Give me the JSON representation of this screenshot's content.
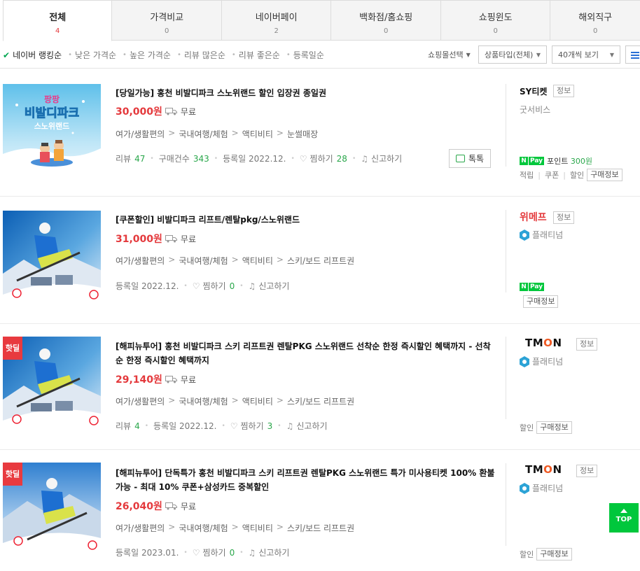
{
  "tabs": [
    {
      "label": "전체",
      "count": "4"
    },
    {
      "label": "가격비교",
      "count": "0"
    },
    {
      "label": "네이버페이",
      "count": "2"
    },
    {
      "label": "백화점/홈쇼핑",
      "count": "0"
    },
    {
      "label": "쇼핑윈도",
      "count": "0"
    },
    {
      "label": "해외직구",
      "count": "0"
    }
  ],
  "sort": {
    "options": [
      "네이버 랭킹순",
      "낮은 가격순",
      "높은 가격순",
      "리뷰 많은순",
      "리뷰 좋은순",
      "등록일순"
    ],
    "shop_select": "쇼핑몰선택",
    "product_type": "상품타입(전체)",
    "page_size": "40개씩 보기"
  },
  "labels": {
    "free_shipping": "무료",
    "review": "리뷰",
    "purchases": "구매건수",
    "registered": "등록일",
    "wish": "찜하기",
    "report": "신고하기",
    "talk": "톡톡",
    "info": "정보",
    "buy_info": "구매정보",
    "platinum": "플래티넘",
    "point": "포인트",
    "top": "TOP",
    "hotdeal": "핫딜",
    "npay_n": "N",
    "npay_pay": "Pay"
  },
  "products": [
    {
      "title": "[당일가능] 홍천 비발디파크 스노위랜드 할인 입장권 종일권",
      "price": "30,000원",
      "categories": [
        "여가/생활편의",
        "국내여행/체험",
        "액티비티",
        "눈썰매장"
      ],
      "review_count": "47",
      "purchase_count": "343",
      "reg_date": "2022.12.",
      "wish_count": "28",
      "seller": "SY티켓",
      "seller_sub": "굿서비스",
      "point_amount": "300원",
      "benefits": [
        "적립",
        "쿠폰",
        "할인"
      ],
      "thumb_text": [
        "팡팡",
        "비발디파크",
        "스노위랜드"
      ]
    },
    {
      "title": "[쿠폰할인] 비발디파크 리프트/렌탈pkg/스노위랜드",
      "price": "31,000원",
      "categories": [
        "여가/생활편의",
        "국내여행/체험",
        "액티비티",
        "스키/보드 리프트권"
      ],
      "reg_date": "2022.12.",
      "wish_count": "0",
      "seller": "위메프"
    },
    {
      "title": "[해피뉴투어] 홍천 비발디파크 스키 리프트권 렌탈PKG 스노위랜드 선착순 한정 즉시할인 혜택까지 - 선착순 한정 즉시할인 혜택까지",
      "price": "29,140원",
      "categories": [
        "여가/생활편의",
        "국내여행/체험",
        "액티비티",
        "스키/보드 리프트권"
      ],
      "review_count": "4",
      "reg_date": "2022.12.",
      "wish_count": "3",
      "seller": "TMON",
      "benefits": [
        "할인"
      ]
    },
    {
      "title": "[해피뉴투어] 단독특가 홍천 비발디파크 스키 리프트권 렌탈PKG 스노위랜드 특가 미사용티켓 100% 환불가능 - 최대 10% 쿠폰+삼성카드 중복할인",
      "price": "26,040원",
      "categories": [
        "여가/생활편의",
        "국내여행/체험",
        "액티비티",
        "스키/보드 리프트권"
      ],
      "reg_date": "2023.01.",
      "wish_count": "0",
      "seller": "TMON",
      "benefits": [
        "할인"
      ]
    }
  ],
  "colors": {
    "accent_red": "#e4393c",
    "naver_green": "#00c73c",
    "count_green": "#2aa74b"
  }
}
